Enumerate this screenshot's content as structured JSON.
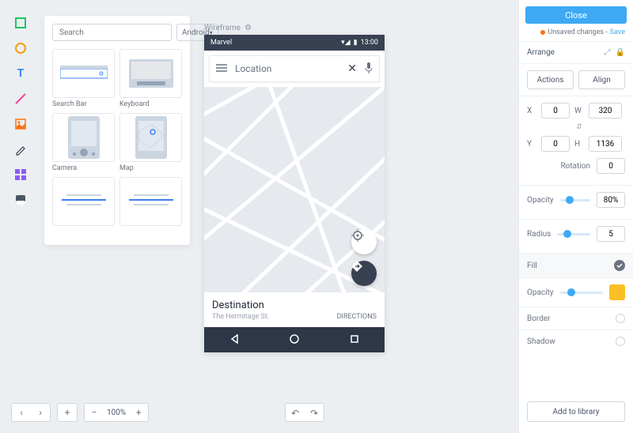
{
  "toolbox": {
    "tools": [
      "rectangle",
      "circle",
      "text",
      "line",
      "image",
      "pen",
      "grid",
      "panel"
    ]
  },
  "components": {
    "search_placeholder": "Search",
    "platform": "Android",
    "items": [
      {
        "label": "Search Bar"
      },
      {
        "label": "Keyboard"
      },
      {
        "label": "Camera"
      },
      {
        "label": "Map"
      },
      {
        "label": ""
      },
      {
        "label": ""
      }
    ]
  },
  "canvas": {
    "label": "Wireframe",
    "statusbar": {
      "title": "Marvel",
      "time": "13:00"
    },
    "search": {
      "placeholder": "Location"
    },
    "destination": {
      "title": "Destination",
      "subtitle": "The Hermitage St.",
      "action": "DIRECTIONS"
    }
  },
  "right": {
    "close": "Close",
    "unsaved": "Unsaved changes -",
    "save": "Save",
    "arrange": "Arrange",
    "actions": "Actions",
    "align": "Align",
    "x": "X",
    "x_val": "0",
    "y": "Y",
    "y_val": "0",
    "w": "W",
    "w_val": "320",
    "h": "H",
    "h_val": "1136",
    "rotation": "Rotation",
    "rotation_val": "0",
    "opacity": "Opacity",
    "opacity_val": "80%",
    "radius": "Radius",
    "radius_val": "5",
    "fill": "Fill",
    "fill_opacity": "Opacity",
    "border": "Border",
    "shadow": "Shadow",
    "add_library": "Add to library"
  },
  "footer": {
    "zoom": "100%"
  }
}
